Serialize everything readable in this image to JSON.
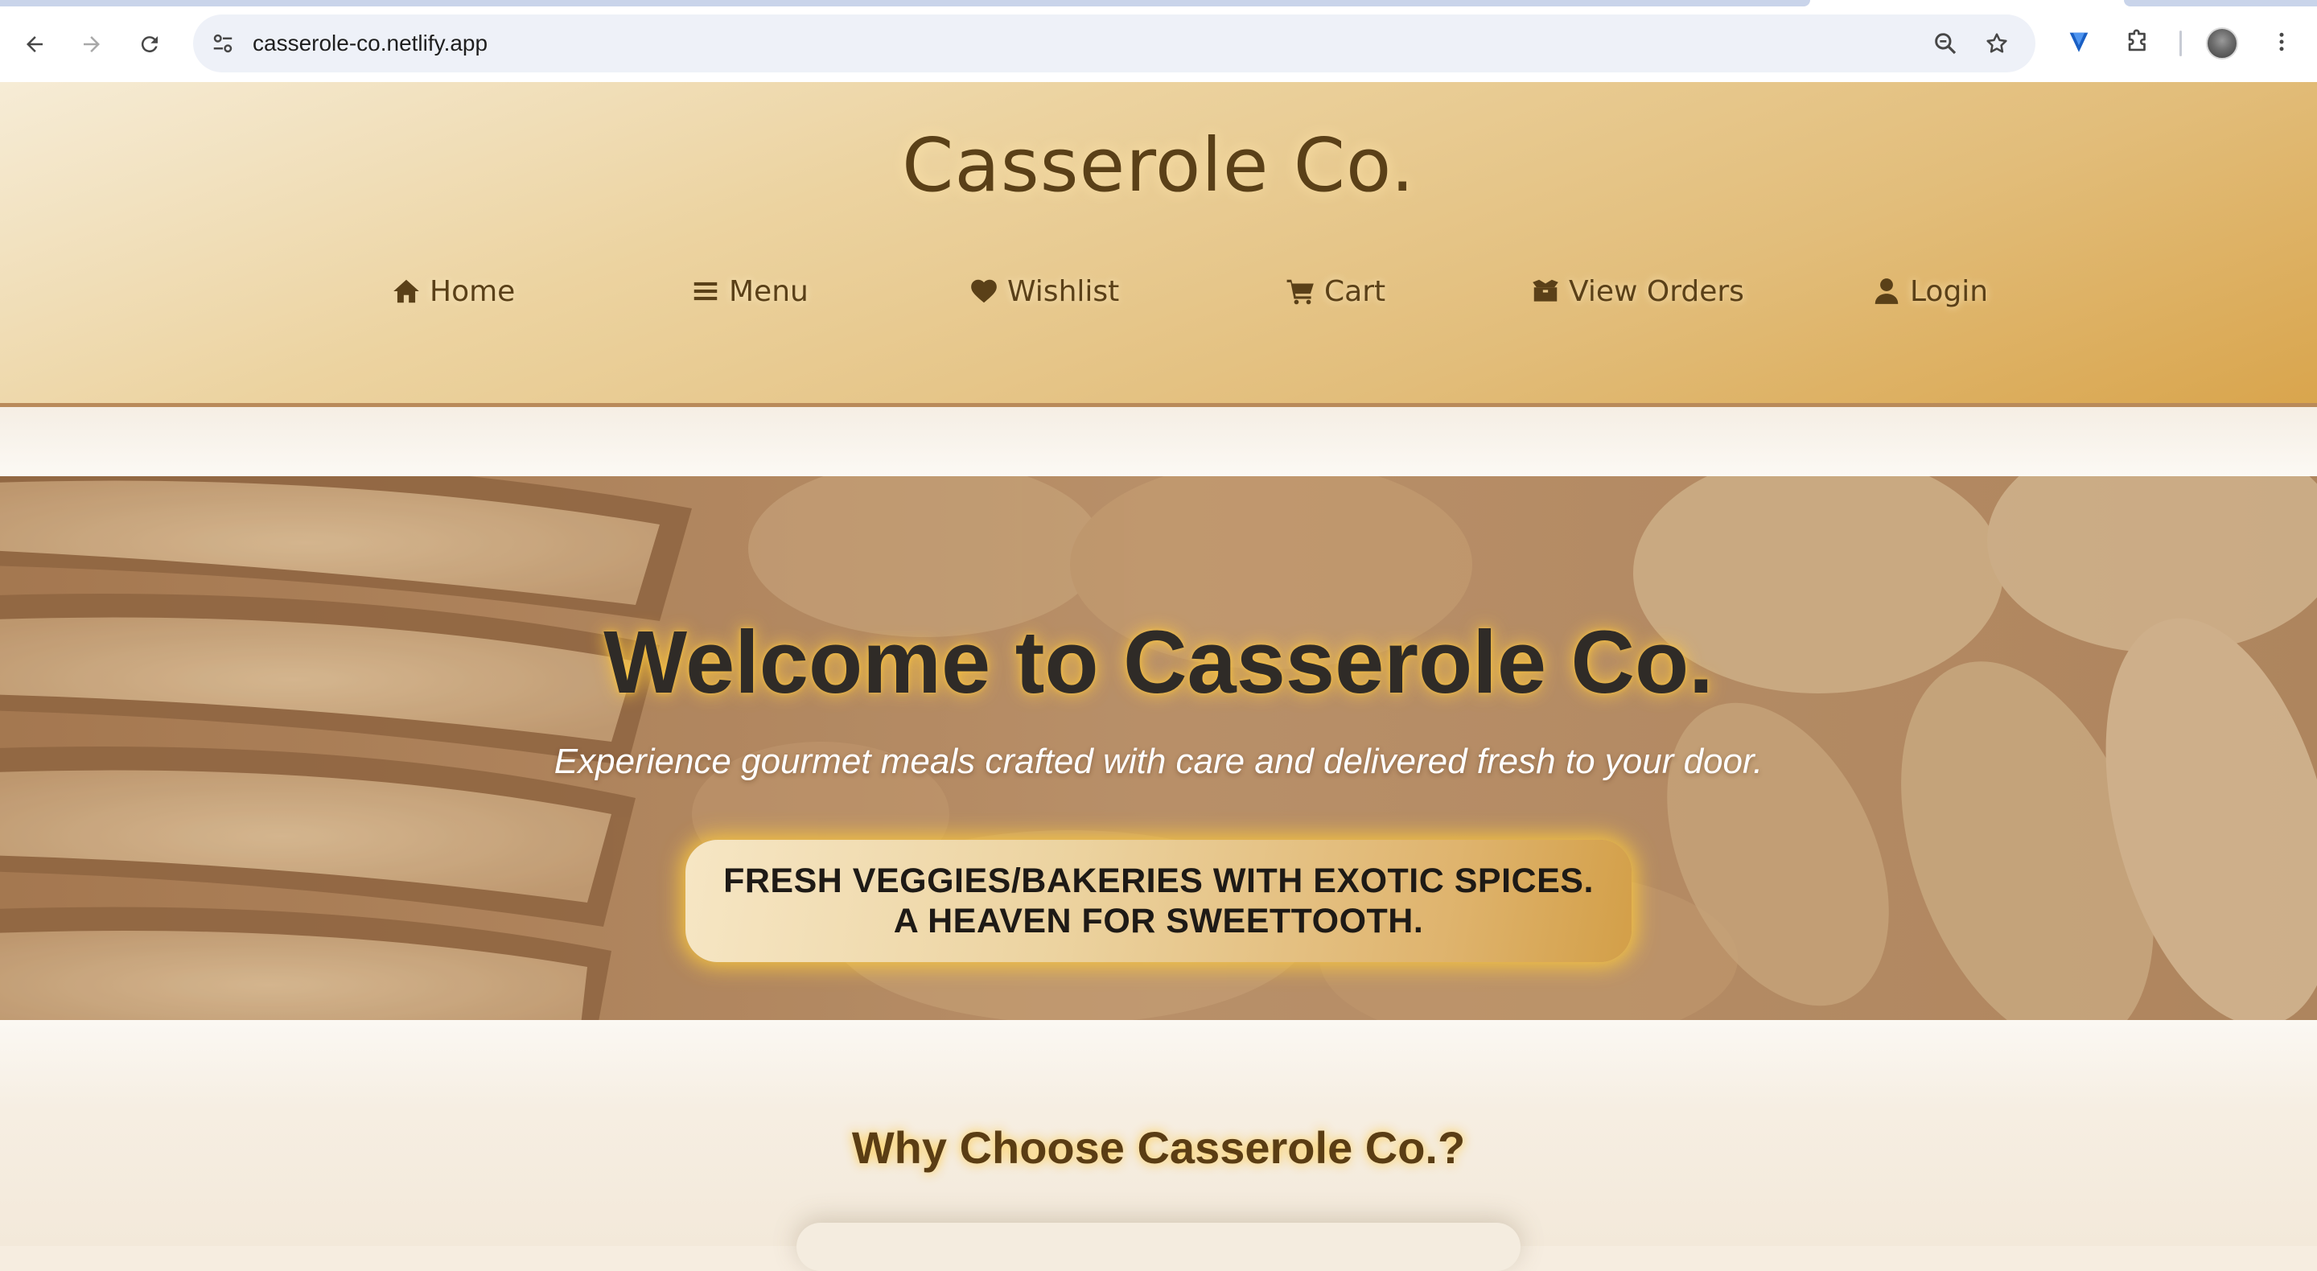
{
  "browser": {
    "url": "casserole-co.netlify.app",
    "nav_icons": [
      "back-arrow-icon",
      "forward-arrow-icon",
      "reload-icon"
    ],
    "omnibox_icons": [
      "site-info-icon",
      "zoom-icon",
      "bookmark-star-icon"
    ],
    "toolbar_icons": [
      "extension-heart-icon",
      "extensions-puzzle-icon",
      "profile-avatar",
      "more-vertical-icon"
    ]
  },
  "header": {
    "title": "Casserole Co.",
    "nav": [
      {
        "label": "Home",
        "icon": "home-icon"
      },
      {
        "label": "Menu",
        "icon": "menu-bars-icon"
      },
      {
        "label": "Wishlist",
        "icon": "heart-icon"
      },
      {
        "label": "Cart",
        "icon": "cart-icon"
      },
      {
        "label": "View Orders",
        "icon": "box-icon"
      },
      {
        "label": "Login",
        "icon": "user-icon"
      }
    ]
  },
  "hero": {
    "title": "Welcome to Casserole Co.",
    "subtitle": "Experience gourmet meals crafted with care and delivered fresh to your door.",
    "badge_line1": "FRESH VEGGIES/BAKERIES WITH EXOTIC SPICES.",
    "badge_line2": "A HEAVEN FOR SWEETTOOTH."
  },
  "why": {
    "title": "Why Choose Casserole Co.?"
  },
  "colors": {
    "header_brown": "#5a4018",
    "header_gold_end": "#d9a54d",
    "hero_glow": "#ffc83c",
    "chrome_accent": "#c9d4ea"
  }
}
